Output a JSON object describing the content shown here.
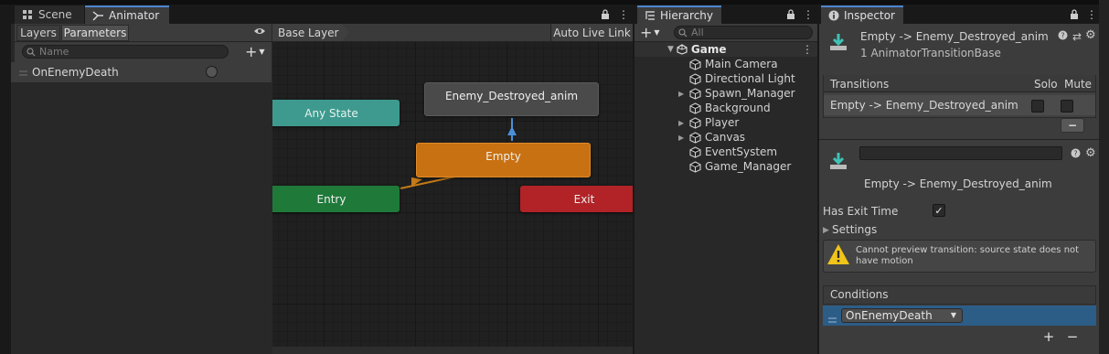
{
  "tabs": {
    "scene": "Scene",
    "animator": "Animator",
    "hierarchy": "Hierarchy",
    "inspector": "Inspector"
  },
  "animator": {
    "layers_tab": "Layers",
    "parameters_tab": "Parameters",
    "search_placeholder": "Name",
    "breadcrumb": "Base Layer",
    "auto_live_link": "Auto Live Link",
    "parameters": [
      {
        "name": "OnEnemyDeath",
        "type": "trigger"
      }
    ],
    "states": {
      "any_state": "Any State",
      "destroyed": "Enemy_Destroyed_anim",
      "empty": "Empty",
      "entry": "Entry",
      "exit": "Exit"
    }
  },
  "hierarchy": {
    "search_placeholder": "All",
    "scene": "Game",
    "items": [
      {
        "label": "Main Camera",
        "expandable": false
      },
      {
        "label": "Directional Light",
        "expandable": false
      },
      {
        "label": "Spawn_Manager",
        "expandable": true
      },
      {
        "label": "Background",
        "expandable": false
      },
      {
        "label": "Player",
        "expandable": true
      },
      {
        "label": "Canvas",
        "expandable": true
      },
      {
        "label": "EventSystem",
        "expandable": false
      },
      {
        "label": "Game_Manager",
        "expandable": false
      }
    ]
  },
  "inspector": {
    "header_title": "Empty -> Enemy_Destroyed_anim",
    "header_subtitle": "1 AnimatorTransitionBase",
    "transitions_label": "Transitions",
    "solo_label": "Solo",
    "mute_label": "Mute",
    "transition_row": "Empty -> Enemy_Destroyed_anim",
    "minus": "−",
    "plus": "+",
    "transition_name_value": "",
    "transition_display": "Empty -> Enemy_Destroyed_anim",
    "has_exit_time_label": "Has Exit Time",
    "has_exit_time": true,
    "settings_label": "Settings",
    "warning": "Cannot preview transition: source state does not have motion",
    "conditions_label": "Conditions",
    "condition_param": "OnEnemyDeath"
  },
  "colors": {
    "any_state": "#3e9a8e",
    "destroyed": "#4a4a4a",
    "empty": "#c87112",
    "entry": "#1f7a3a",
    "exit": "#b12327",
    "selection": "#2c5d87",
    "accent": "#4d85d0"
  }
}
